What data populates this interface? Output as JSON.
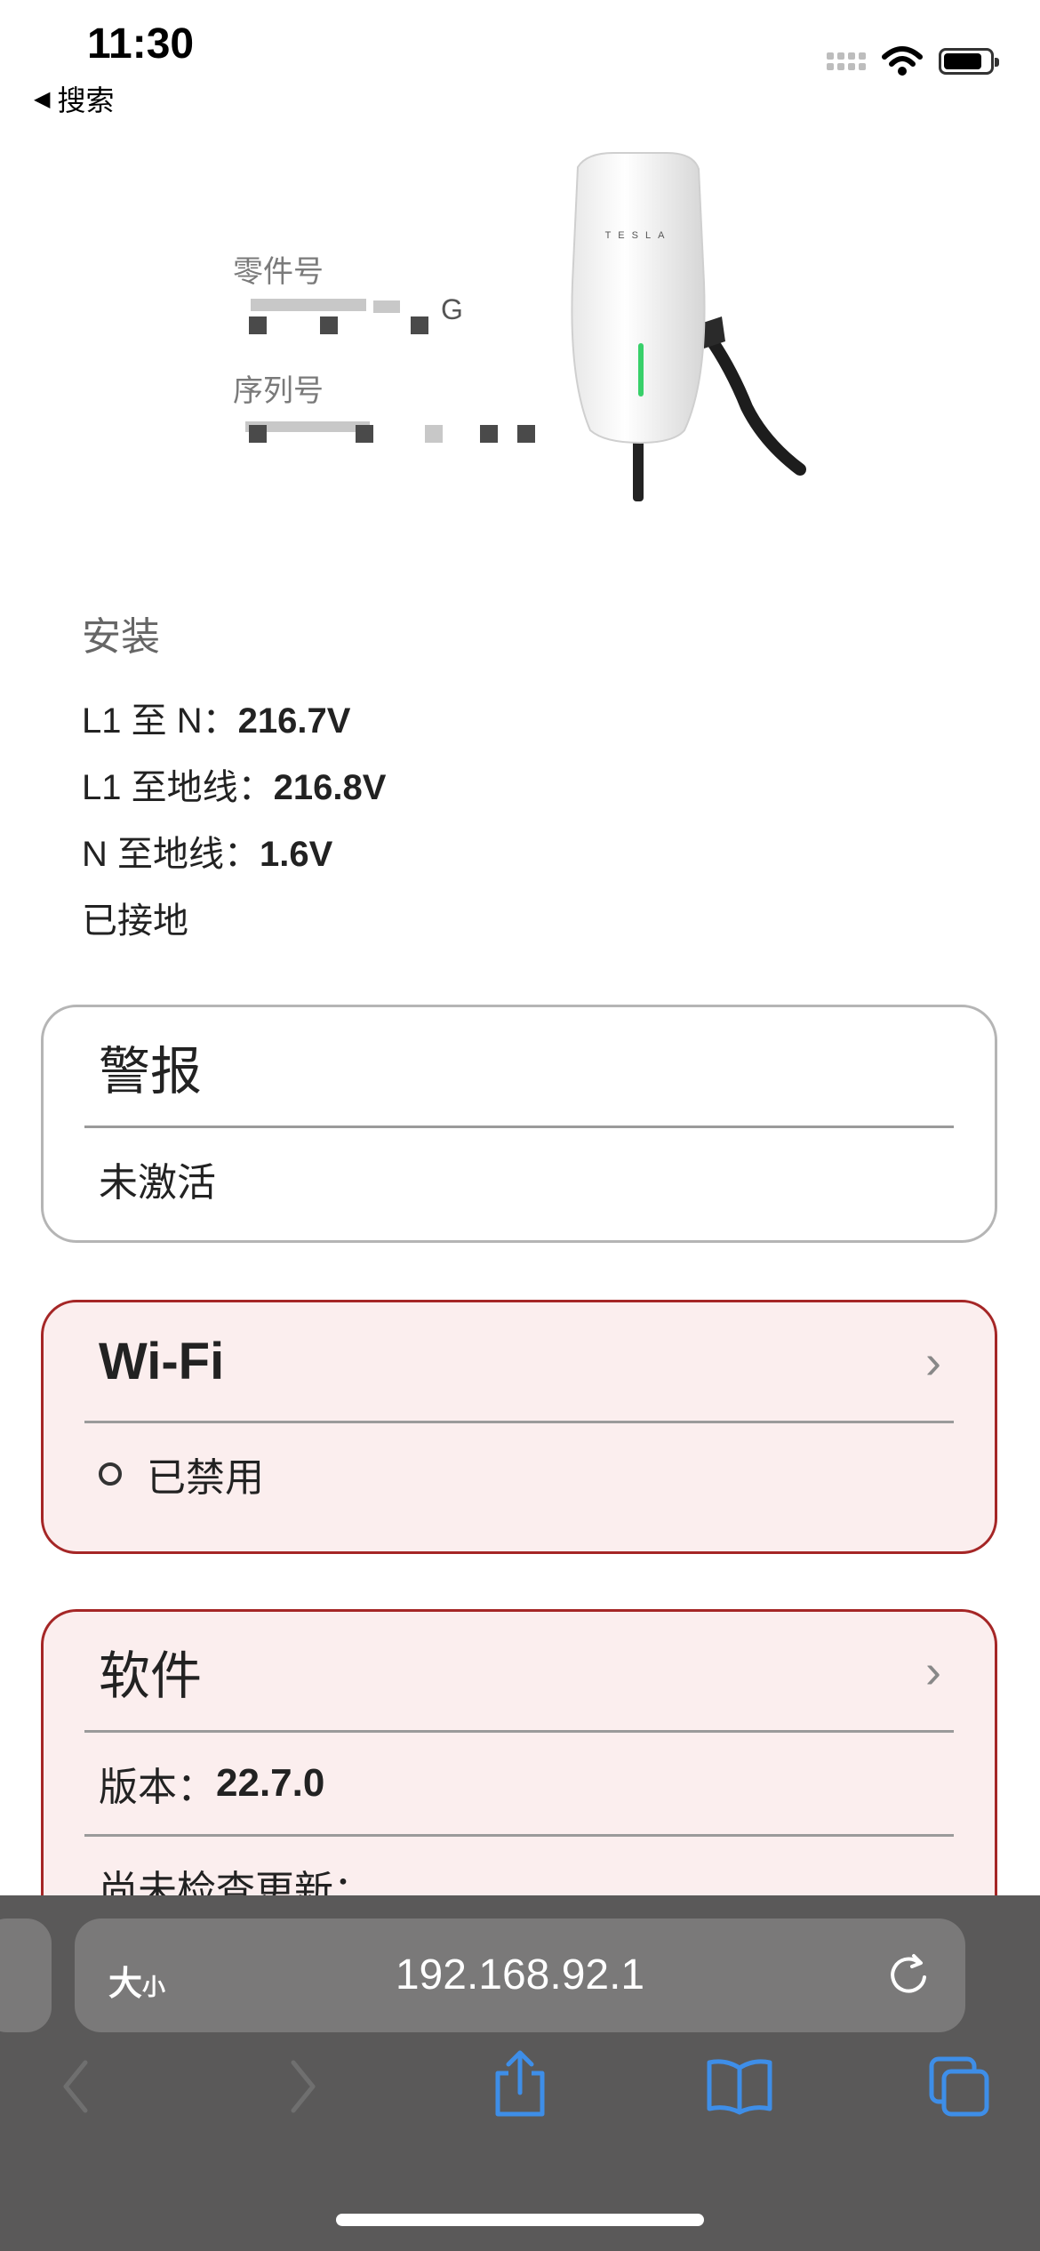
{
  "status_bar": {
    "time": "11:30",
    "back_label": "搜索"
  },
  "device": {
    "part_label": "零件号",
    "part_value_suffix": "G",
    "serial_label": "序列号",
    "brand": "TESLA"
  },
  "install": {
    "heading": "安装",
    "rows": [
      {
        "label": "L1 至 N：",
        "value": "216.7V"
      },
      {
        "label": "L1 至地线：",
        "value": "216.8V"
      },
      {
        "label": "N 至地线：",
        "value": "1.6V"
      }
    ],
    "ground_status": "已接地"
  },
  "alarm_card": {
    "title": "警报",
    "status": "未激活"
  },
  "wifi_card": {
    "title": "Wi-Fi",
    "status": "已禁用"
  },
  "software_card": {
    "title": "软件",
    "version_label": "版本：",
    "version_value": "22.7.0",
    "update_status": "尚未检查更新："
  },
  "browser": {
    "text_size_big": "大",
    "text_size_small": "小",
    "url": "192.168.92.1"
  },
  "colors": {
    "card_red_border": "#a52626",
    "card_red_bg": "#fbeeee",
    "accent_blue": "#3e8ee8",
    "toolbar_bg": "#5a5959"
  }
}
